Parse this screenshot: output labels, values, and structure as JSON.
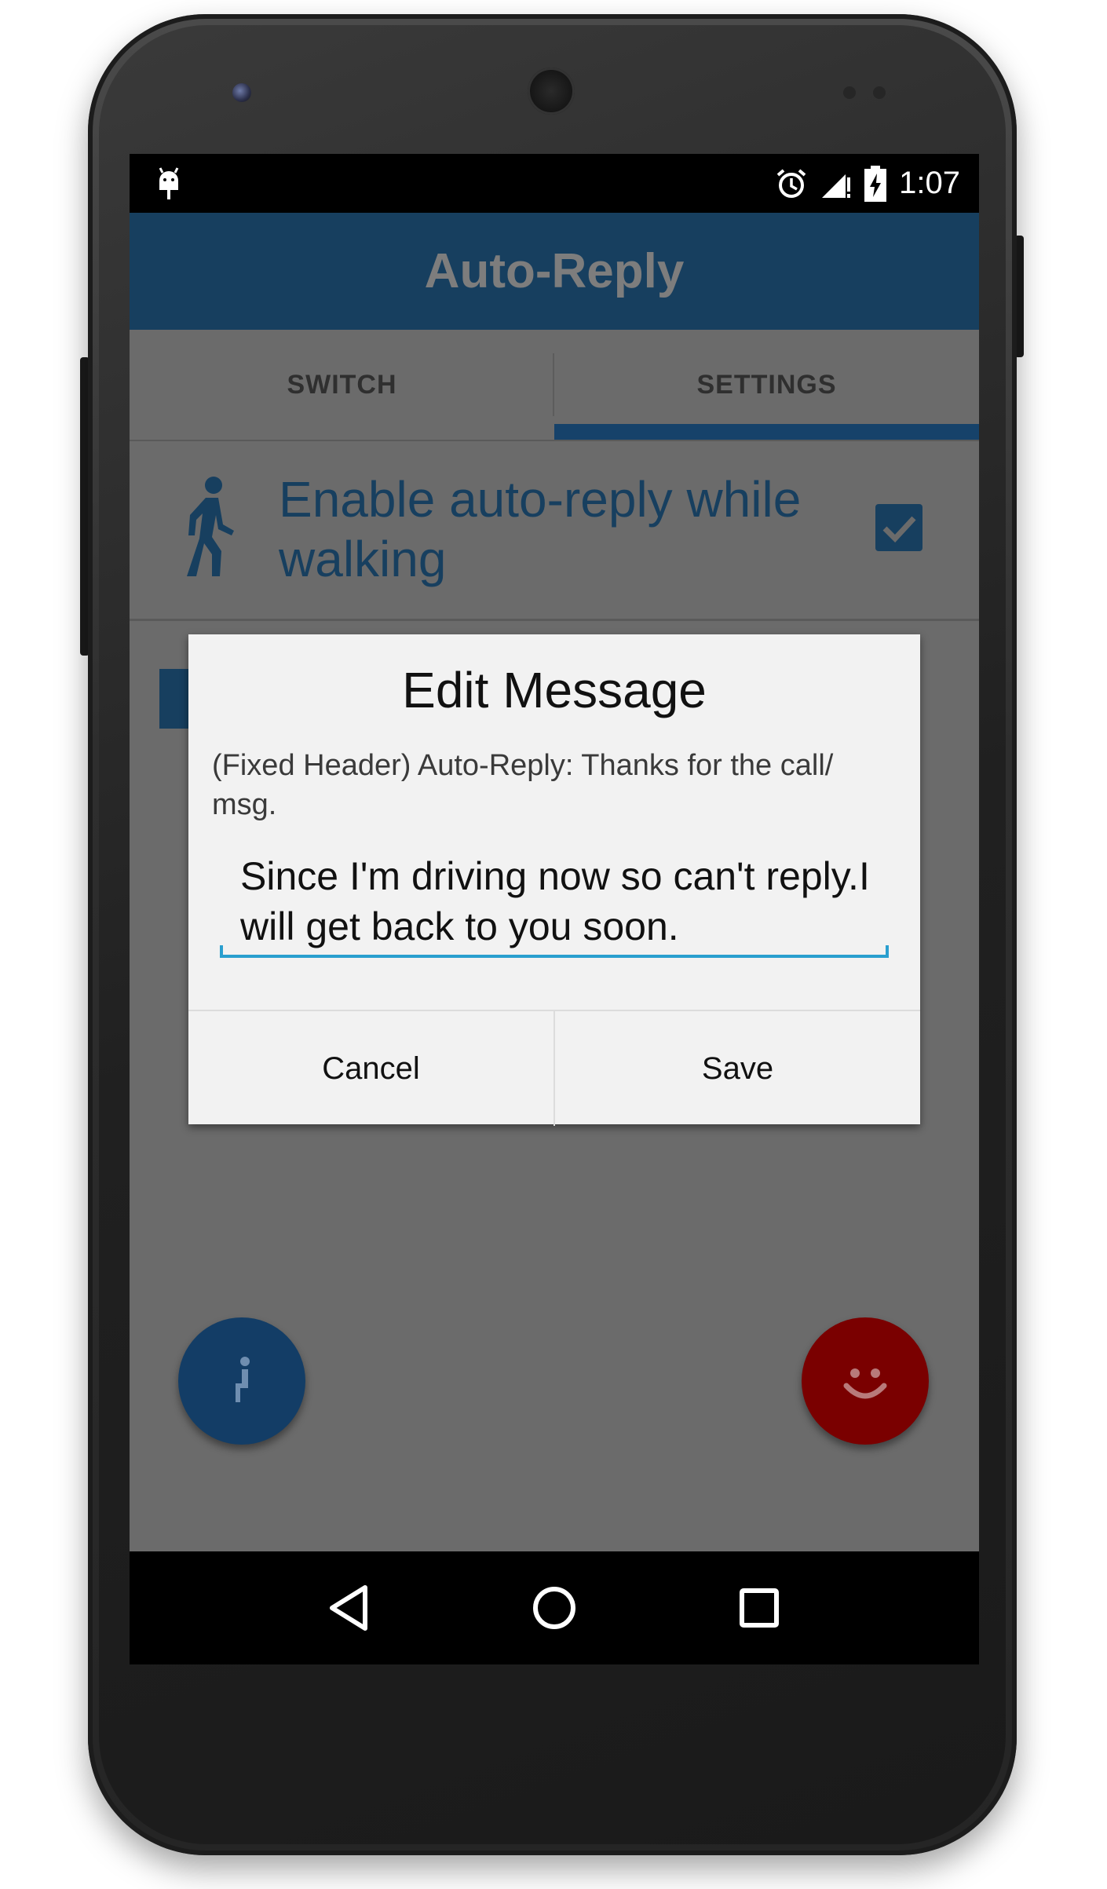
{
  "status_bar": {
    "time": "1:07",
    "icons": [
      "android-debug-icon",
      "alarm-icon",
      "signal-icon",
      "battery-charging-icon"
    ]
  },
  "app_bar": {
    "title": "Auto-Reply"
  },
  "tabs": [
    {
      "label": "SWITCH",
      "selected": false
    },
    {
      "label": "SETTINGS",
      "selected": true
    }
  ],
  "settings": {
    "walking_label": "Enable auto-reply while walking",
    "walking_enabled": true
  },
  "dialog": {
    "title": "Edit Message",
    "fixed_header": "(Fixed Header) Auto-Reply: Thanks for the call/ msg.",
    "message_value": "Since I'm driving now so can't reply.I will get back to you soon.",
    "cancel_label": "Cancel",
    "save_label": "Save"
  },
  "fabs": {
    "left_icon": "seated-person-icon",
    "right_icon": "smiley-icon"
  },
  "nav": {
    "icons": [
      "back-icon",
      "home-icon",
      "recents-icon"
    ]
  },
  "colors": {
    "primary": "#173f5f",
    "accent_line": "#2a9fcf",
    "fab_left": "#133d66",
    "fab_right": "#7a0000"
  }
}
